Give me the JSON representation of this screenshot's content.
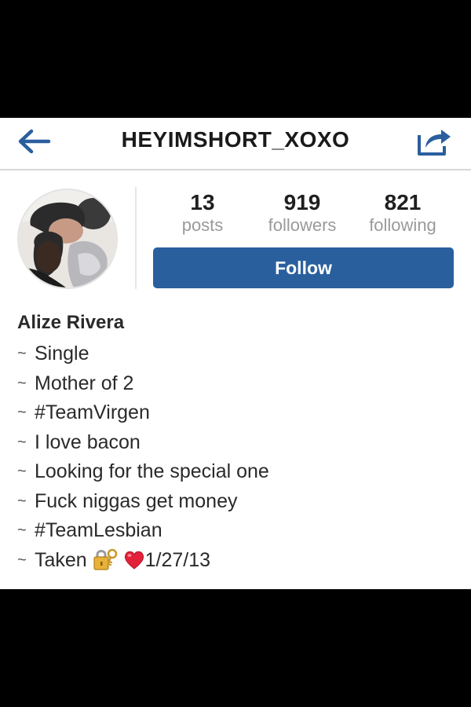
{
  "app": {
    "accent_color": "#2a5f9e",
    "background_color": "#ffffff"
  },
  "navbar": {
    "back_icon": "arrow-left-icon",
    "title": "HEYIMSHORT_XOXO",
    "share_icon": "share-icon"
  },
  "profile": {
    "avatar_icon": "profile-photo",
    "stats": [
      {
        "value": "13",
        "label": "posts"
      },
      {
        "value": "919",
        "label": "followers"
      },
      {
        "value": "821",
        "label": "following"
      }
    ],
    "follow_button_label": "Follow"
  },
  "bio": {
    "name": "Alize Rivera",
    "bullet": "~",
    "lines": [
      {
        "text": "Single"
      },
      {
        "text": "Mother of 2"
      },
      {
        "text": "#TeamVirgen"
      },
      {
        "text": "I love bacon"
      },
      {
        "text": "Looking for the special one"
      },
      {
        "text": "Fuck niggas get money"
      },
      {
        "text": "#TeamLesbian"
      },
      {
        "text": "Taken",
        "icons": [
          "lock-with-key-icon",
          "red-heart-icon"
        ],
        "date": "1/27/13"
      }
    ]
  }
}
